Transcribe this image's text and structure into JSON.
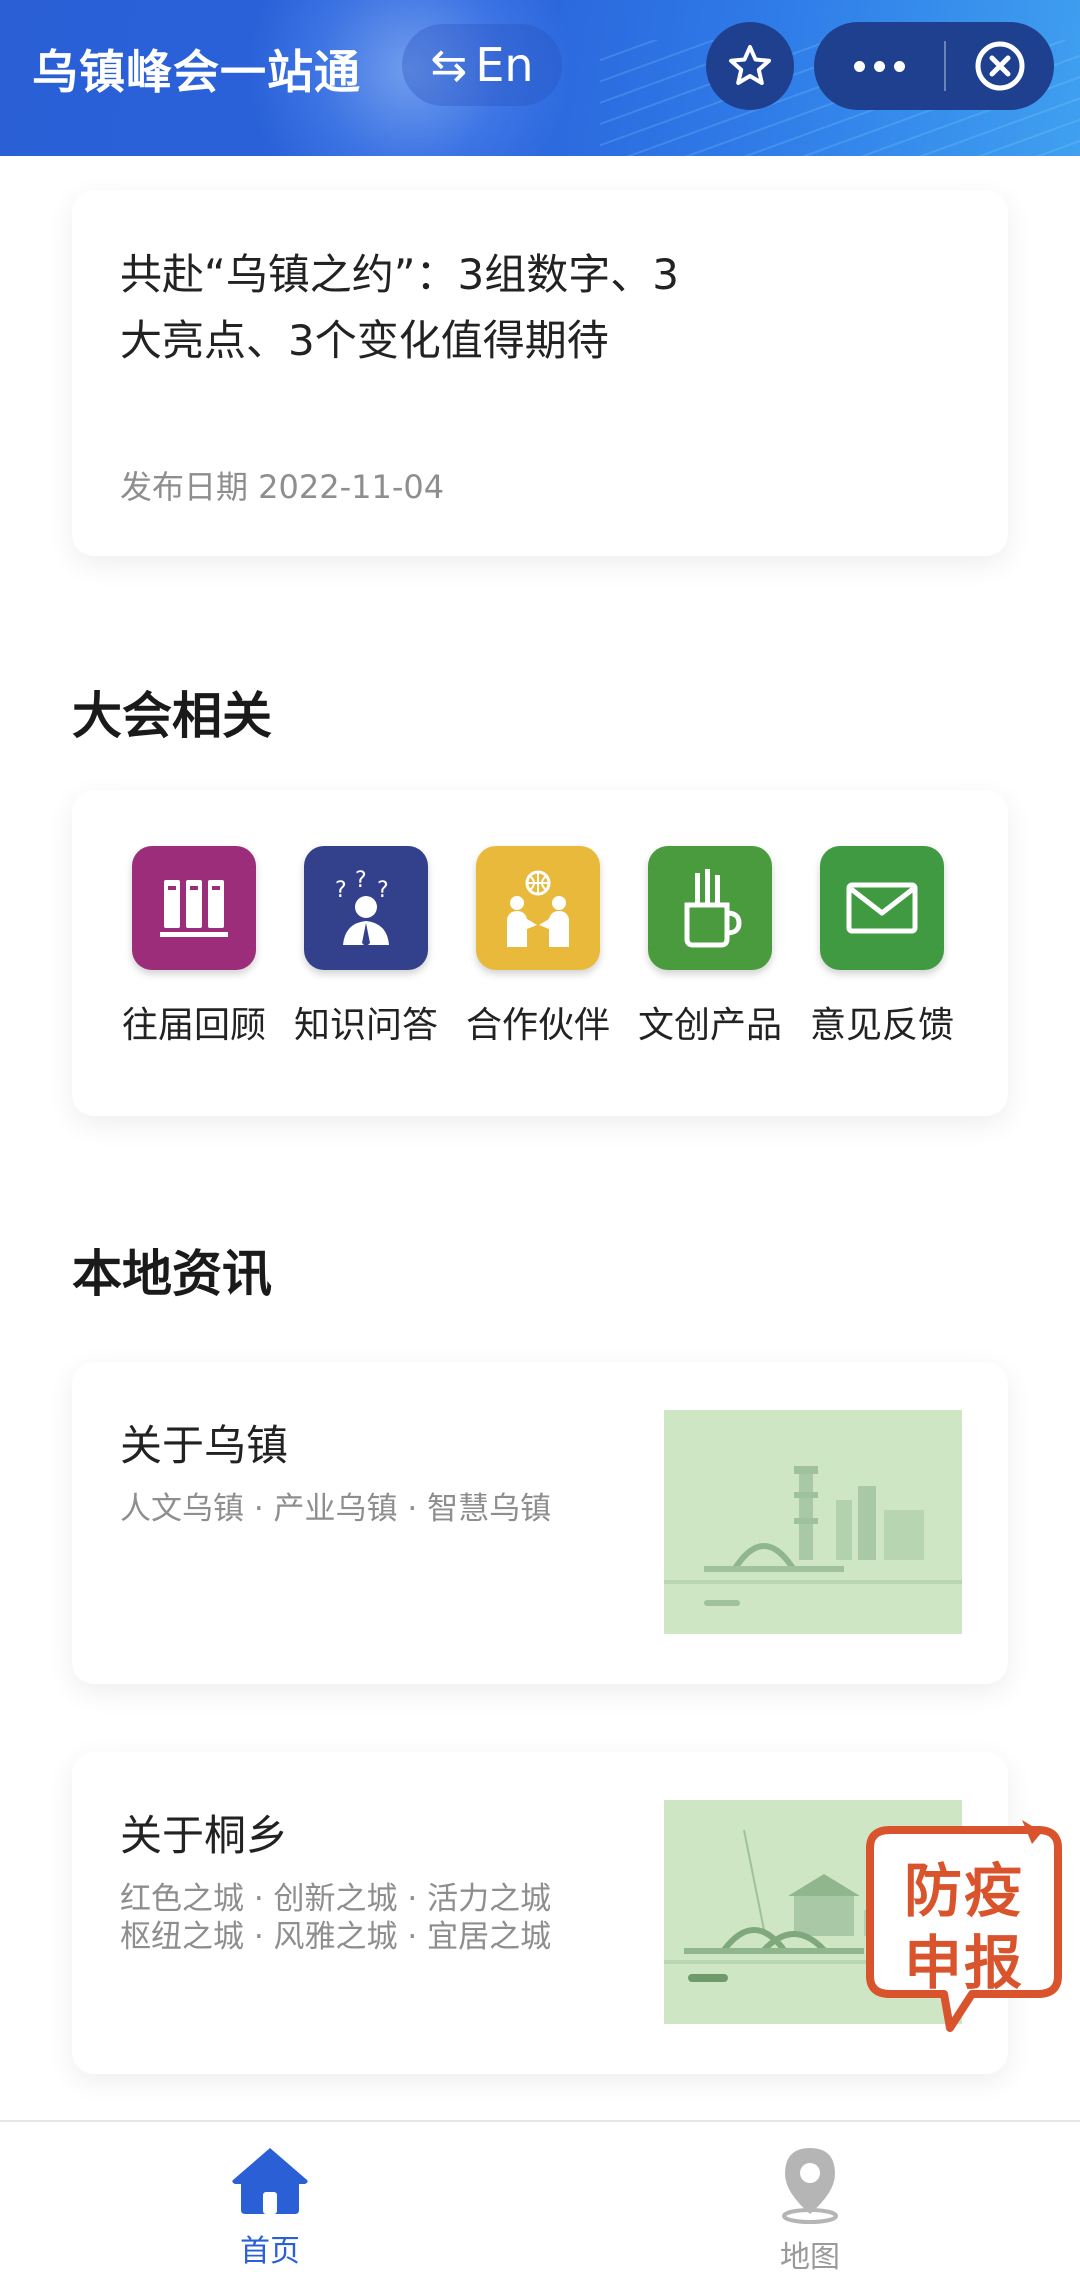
{
  "header": {
    "title": "乌镇峰会一站通",
    "lang_switch": "En",
    "favorite_icon": "star-icon",
    "more_icon": "more-dots-icon",
    "close_icon": "close-circle-icon",
    "background_color": "#2a5fd6"
  },
  "news": {
    "title": "共赴“乌镇之约”：3组数字、3大亮点、3个变化值得期待",
    "date": "发布日期 2022-11-04"
  },
  "conference": {
    "title": "大会相关",
    "items": [
      {
        "label": "往届回顾",
        "icon": "bookshelf-icon",
        "color": "#9b2d7a"
      },
      {
        "label": "知识问答",
        "icon": "question-person-icon",
        "color": "#33408c"
      },
      {
        "label": "合作伙伴",
        "icon": "handshake-globe-icon",
        "color": "#e8b93a"
      },
      {
        "label": "文创产品",
        "icon": "pen-cup-icon",
        "color": "#4a9a3e"
      },
      {
        "label": "意见反馈",
        "icon": "envelope-icon",
        "color": "#3f9a42"
      }
    ]
  },
  "local": {
    "title": "本地资讯",
    "items": [
      {
        "title": "关于乌镇",
        "subtitle": "人文乌镇 · 产业乌镇 · 智慧乌镇"
      },
      {
        "title": "关于桐乡",
        "subtitle": "红色之城 · 创新之城 · 活力之城\n枢纽之城 · 风雅之城 · 宜居之城"
      }
    ]
  },
  "floating_badge": {
    "line1": "防疫",
    "line2": "申报",
    "color": "#d9542c"
  },
  "tabbar": {
    "tabs": [
      {
        "label": "首页",
        "icon": "home-icon",
        "active": true,
        "color": "#2a5fd6"
      },
      {
        "label": "地图",
        "icon": "map-pin-icon",
        "active": false,
        "color": "#9a9a9a"
      }
    ]
  }
}
